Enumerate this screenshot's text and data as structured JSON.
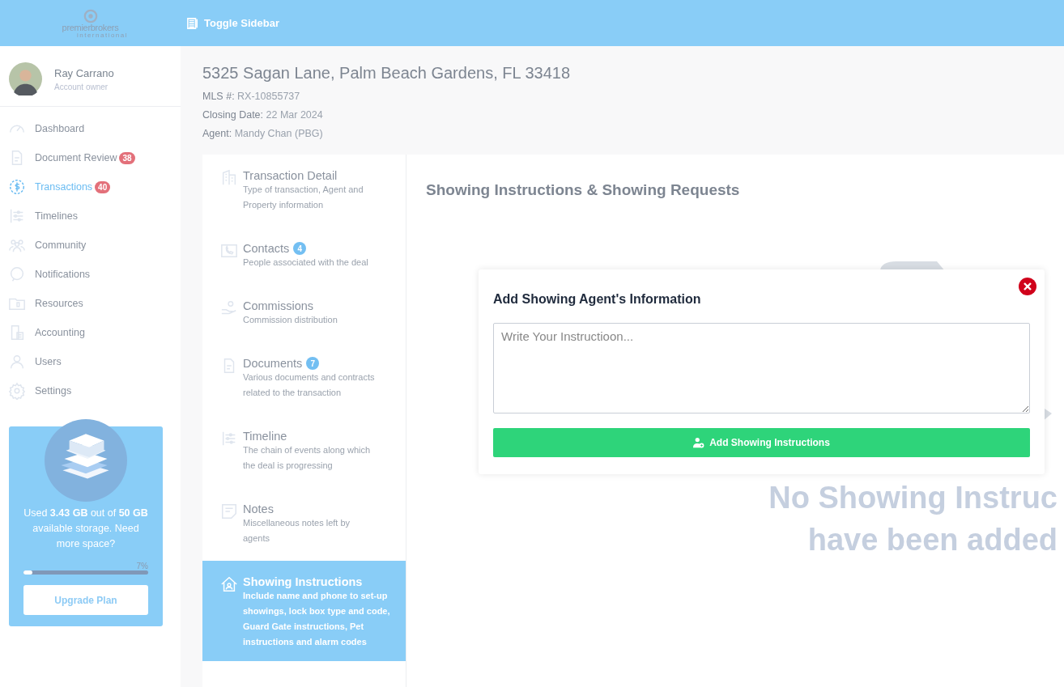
{
  "header": {
    "logo_text": "premierbrokers",
    "logo_subtext": "international",
    "toggle_label": "Toggle Sidebar"
  },
  "user": {
    "name": "Ray Carrano",
    "role": "Account owner"
  },
  "nav": [
    {
      "label": "Dashboard",
      "selected": false
    },
    {
      "label": "Document Review",
      "badge": "38",
      "selected": false
    },
    {
      "label": "Transactions",
      "badge": "40",
      "selected": true
    },
    {
      "label": "Timelines",
      "selected": false
    },
    {
      "label": "Community",
      "selected": false
    },
    {
      "label": "Notifications",
      "selected": false
    },
    {
      "label": "Resources",
      "selected": false
    },
    {
      "label": "Accounting",
      "selected": false
    },
    {
      "label": "Users",
      "selected": false
    },
    {
      "label": "Settings",
      "selected": false
    }
  ],
  "storage": {
    "text": "Used **3.43 GB** out of **50 GB** available storage. Need more space?",
    "percent": "7%",
    "level": 0.07,
    "button": "Upgrade Plan"
  },
  "property": {
    "address": "5325 Sagan Lane, Palm Beach Gardens, FL 33418",
    "fields": [
      {
        "label": "MLS #:",
        "value": "RX-10855737"
      },
      {
        "label": "Closing Date:",
        "value": "22 Mar 2024"
      },
      {
        "label": "Agent:",
        "value": "Mandy Chan (PBG)"
      }
    ]
  },
  "sections": [
    {
      "title": "Transaction Detail",
      "description": "Type of transaction, Agent and Property information",
      "selected": false
    },
    {
      "title": "Contacts",
      "badge": "4",
      "description": "People associated with the deal",
      "selected": false
    },
    {
      "title": "Commissions",
      "description": "Commission distribution",
      "selected": false
    },
    {
      "title": "Documents",
      "badge": "7",
      "description": "Various documents and contracts related to the transaction",
      "selected": false
    },
    {
      "title": "Timeline",
      "description": "The chain of events along which the deal is progressing",
      "selected": false
    },
    {
      "title": "Notes",
      "description": "Miscellaneous notes left by agents",
      "selected": false
    },
    {
      "title": "Showing Instructions",
      "description": "Include name and phone to set-up showings, lock box type and code, Guard Gate instructions, Pet instructions and alarm codes",
      "selected": true
    }
  ],
  "panel": {
    "title": "Showing Instructions & Showing Requests",
    "empty_lines": [
      "No Showing Instruc",
      "have been added"
    ]
  },
  "modal": {
    "title": "Add Showing Agent's Information",
    "placeholder": "Write Your Instructioon...",
    "button": "Add Showing Instructions"
  }
}
